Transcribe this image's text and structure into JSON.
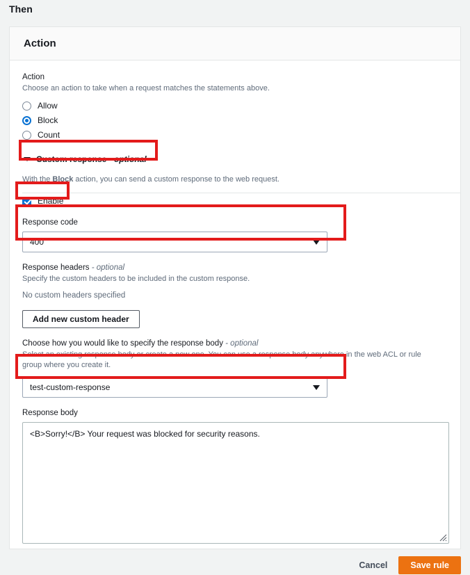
{
  "page": {
    "section_heading": "Then"
  },
  "card": {
    "title": "Action",
    "action": {
      "label": "Action",
      "description": "Choose an action to take when a request matches the statements above.",
      "options": [
        {
          "label": "Allow",
          "selected": false
        },
        {
          "label": "Block",
          "selected": true
        },
        {
          "label": "Count",
          "selected": false
        }
      ]
    },
    "custom_response": {
      "title": "Custom response",
      "title_optional": " - optional",
      "description_prefix": "With the ",
      "description_strong": "Block",
      "description_suffix": " action, you can send a custom response to the web request.",
      "description_full": "With the Block action, you can send a custom response to the web request.",
      "enable_label": "Enable",
      "enable_checked": true,
      "response_code": {
        "label": "Response code",
        "value": "400"
      },
      "response_headers": {
        "label": "Response headers",
        "label_optional": " - optional",
        "description": "Specify the custom headers to be included in the custom response.",
        "empty_state": "No custom headers specified",
        "add_button": "Add new custom header"
      },
      "response_body_choice": {
        "label": "Choose how you would like to specify the response body",
        "label_optional": " - optional",
        "description": "Select an existing response body or create a new one. You can use a response body anywhere in the web ACL or rule group where you create it.",
        "value": "test-custom-response"
      },
      "response_body": {
        "label": "Response body",
        "value": "<B>Sorry!</B> Your request was blocked for security reasons."
      }
    }
  },
  "footer": {
    "cancel_label": "Cancel",
    "save_label": "Save rule"
  },
  "colors": {
    "accent_blue": "#0972d3",
    "primary_orange": "#ec7211",
    "annotation_red": "#e31b1b",
    "page_background": "#f1f3f3"
  }
}
